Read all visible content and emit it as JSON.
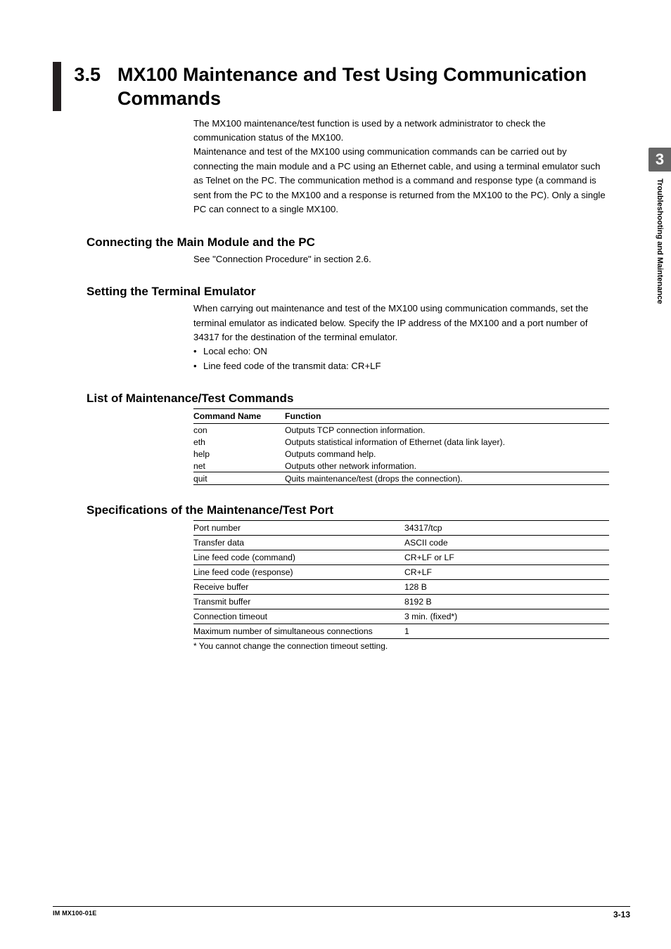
{
  "chapter": {
    "num": "3",
    "tab_label": "Troubleshooting and Maintenance"
  },
  "section": {
    "num": "3.5",
    "title": "MX100 Maintenance and Test Using Communication Commands",
    "intro": "The MX100 maintenance/test function is used by a network administrator to check the communication status of the MX100.\nMaintenance and test of the MX100 using communication commands can be carried out by connecting the main module and a PC using an Ethernet cable, and using a terminal emulator such as Telnet on the PC. The communication method is a command and response type (a command is sent from the PC to the MX100 and a response is returned from the MX100 to the PC). Only a single PC can connect to a single MX100."
  },
  "connect": {
    "heading": "Connecting the Main Module and the PC",
    "text": "See \"Connection Procedure\" in section 2.6."
  },
  "emulator": {
    "heading": "Setting the Terminal Emulator",
    "text": "When carrying out maintenance and test of the MX100 using communication commands, set the terminal emulator as indicated below. Specify the IP address of the MX100 and a port number of 34317 for the destination of the terminal emulator.",
    "bullets": [
      "Local echo: ON",
      "Line feed code of the transmit data: CR+LF"
    ]
  },
  "commands": {
    "heading": "List of Maintenance/Test Commands",
    "headers": {
      "name": "Command Name",
      "func": "Function"
    },
    "rows": [
      {
        "name": "con",
        "func": "Outputs TCP connection information."
      },
      {
        "name": "eth",
        "func": "Outputs statistical information of Ethernet (data link layer)."
      },
      {
        "name": "help",
        "func": "Outputs command help."
      },
      {
        "name": "net",
        "func": "Outputs other network information."
      },
      {
        "name": "quit",
        "func": "Quits maintenance/test (drops the connection)."
      }
    ]
  },
  "specs": {
    "heading": "Specifications of the Maintenance/Test Port",
    "rows": [
      {
        "k": "Port number",
        "v": "34317/tcp"
      },
      {
        "k": "Transfer data",
        "v": "ASCII code"
      },
      {
        "k": "Line feed code (command)",
        "v": "CR+LF or LF"
      },
      {
        "k": "Line feed code (response)",
        "v": "CR+LF"
      },
      {
        "k": "Receive buffer",
        "v": "128 B"
      },
      {
        "k": "Transmit buffer",
        "v": "8192 B"
      },
      {
        "k": "Connection timeout",
        "v": "3 min. (fixed*)"
      },
      {
        "k": "Maximum number of simultaneous connections",
        "v": "1"
      }
    ],
    "footnote": "* You cannot change the connection timeout setting."
  },
  "footer": {
    "left": "IM MX100-01E",
    "right": "3-13"
  }
}
